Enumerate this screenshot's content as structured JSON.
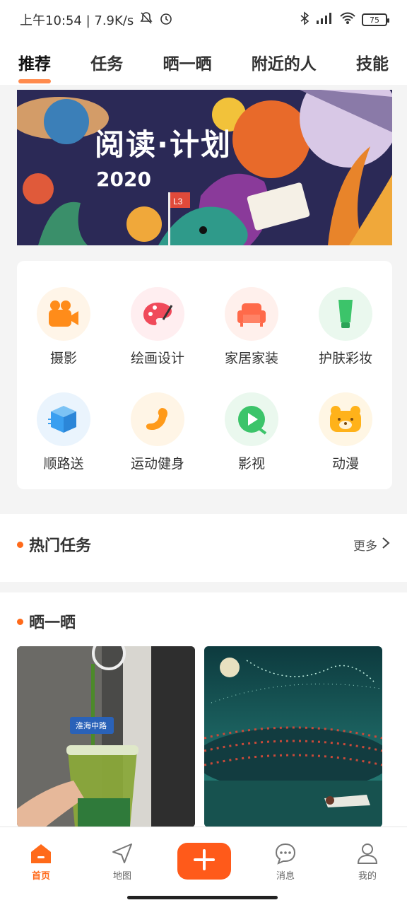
{
  "status_bar": {
    "time_speed": "上午10:54 | 7.9K/s",
    "battery": "75"
  },
  "top_tabs": [
    "推荐",
    "任务",
    "晒一晒",
    "附近的人",
    "技能"
  ],
  "banner": {
    "title": "阅读·计划",
    "year": "2020",
    "flag": "L3"
  },
  "categories": [
    {
      "label": "摄影",
      "icon": "camera-icon",
      "color": "#ff8c1a",
      "bg": "#fff5e8"
    },
    {
      "label": "绘画设计",
      "icon": "palette-icon",
      "color": "#f04a5a",
      "bg": "#ffeef0"
    },
    {
      "label": "家居家装",
      "icon": "sofa-icon",
      "color": "#ff6a4a",
      "bg": "#fff0ec"
    },
    {
      "label": "护肤彩妆",
      "icon": "lotion-icon",
      "color": "#3cc46a",
      "bg": "#eaf8ee"
    },
    {
      "label": "顺路送",
      "icon": "box-icon",
      "color": "#3a9ff0",
      "bg": "#eaf4fd"
    },
    {
      "label": "运动健身",
      "icon": "muscle-icon",
      "color": "#ff9a1a",
      "bg": "#fff5e6"
    },
    {
      "label": "影视",
      "icon": "play-icon",
      "color": "#3cc46a",
      "bg": "#eaf8ee"
    },
    {
      "label": "动漫",
      "icon": "bear-icon",
      "color": "#ffb21a",
      "bg": "#fff6e4"
    }
  ],
  "hot_tasks": {
    "title": "热门任务",
    "more": "更多"
  },
  "show_section": {
    "title": "晒一晒",
    "sign_text": "淮海中路"
  },
  "bottom_nav": {
    "home": "首页",
    "map": "地图",
    "messages": "消息",
    "mine": "我的"
  },
  "accent": "#ff6a1a"
}
